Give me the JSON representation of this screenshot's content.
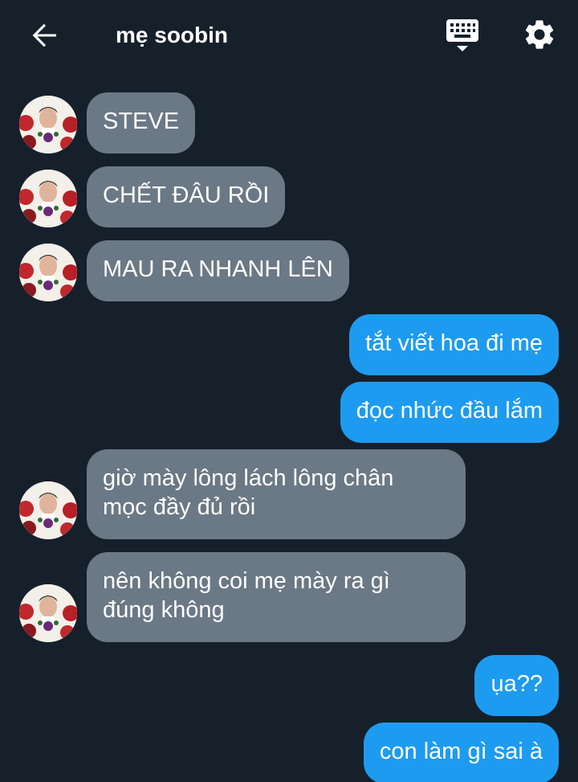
{
  "header": {
    "title": "mẹ soobin",
    "back_icon": "arrow-left-icon",
    "keyboard_icon": "keyboard-icon",
    "settings_icon": "gear-icon"
  },
  "colors": {
    "background": "#16202b",
    "incoming_bubble": "#6b7885",
    "outgoing_bubble": "#1d9bf0",
    "text": "#ffffff"
  },
  "messages": [
    {
      "direction": "incoming",
      "lines": [
        "STEVE"
      ]
    },
    {
      "direction": "incoming",
      "lines": [
        "CHẾT ĐÂU RỒI"
      ]
    },
    {
      "direction": "incoming",
      "lines": [
        "MAU RA NHANH LÊN"
      ]
    },
    {
      "direction": "outgoing",
      "lines": [
        "tắt viết hoa đi mẹ"
      ]
    },
    {
      "direction": "outgoing",
      "lines": [
        "đọc nhức đầu lắm"
      ]
    },
    {
      "direction": "incoming",
      "lines": [
        "giờ mày lông lách lông chân",
        "mọc đầy đủ rồi"
      ]
    },
    {
      "direction": "incoming",
      "lines": [
        "nên không coi mẹ mày ra gì",
        "đúng không"
      ]
    },
    {
      "direction": "outgoing",
      "lines": [
        "ụa??"
      ]
    },
    {
      "direction": "outgoing",
      "lines": [
        "con làm gì sai à"
      ]
    }
  ]
}
